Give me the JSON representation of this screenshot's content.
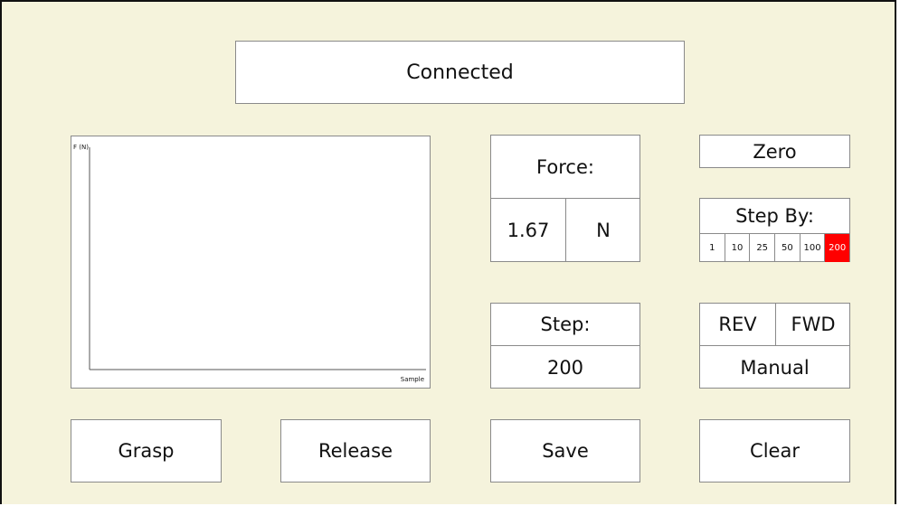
{
  "status": {
    "label": "Connected"
  },
  "plot": {
    "y_axis_label": "F (N)",
    "x_axis_label": "Sample"
  },
  "force": {
    "title": "Force:",
    "value": "1.67",
    "unit": "N"
  },
  "step": {
    "title": "Step:",
    "value": "200"
  },
  "zero": {
    "label": "Zero"
  },
  "step_by": {
    "title": "Step By:",
    "options": [
      "1",
      "10",
      "25",
      "50",
      "100",
      "200"
    ],
    "selected": "200",
    "selected_color": "#ff0000"
  },
  "manual": {
    "rev_label": "REV",
    "fwd_label": "FWD",
    "mode_label": "Manual"
  },
  "buttons": {
    "grasp": "Grasp",
    "release": "Release",
    "save": "Save",
    "clear": "Clear"
  }
}
